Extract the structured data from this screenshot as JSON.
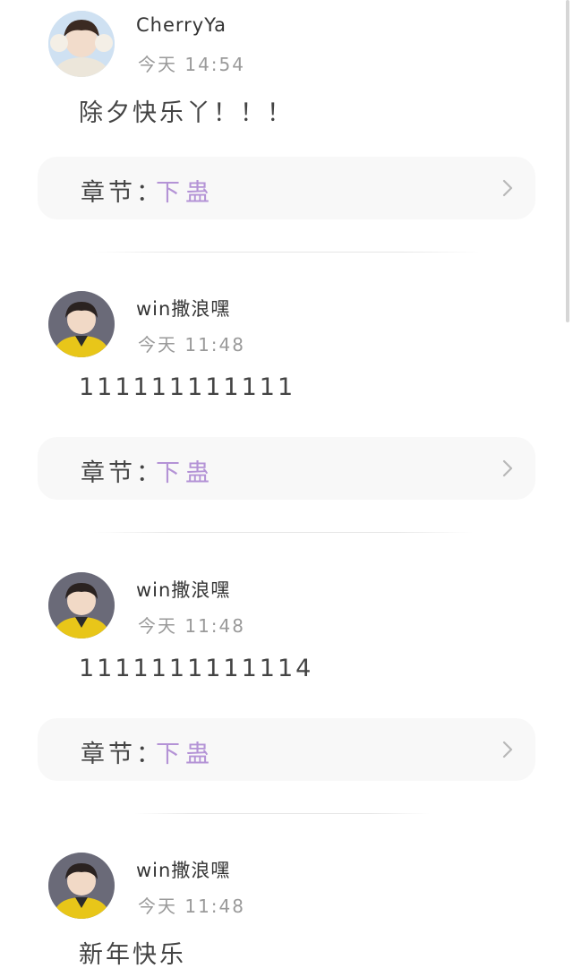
{
  "comments": [
    {
      "username": "CherryYa",
      "time": "今天 14:54",
      "text": "除夕快乐丫！！！",
      "chapter_label": "章节：",
      "chapter_name": "下蛊",
      "avatar_icon": "avatar-photo"
    },
    {
      "username": "win撒浪嘿",
      "time": "今天 11:48",
      "text": "111111111111",
      "chapter_label": "章节：",
      "chapter_name": "下蛊",
      "avatar_icon": "avatar-photo"
    },
    {
      "username": "win撒浪嘿",
      "time": "今天 11:48",
      "text": "1111111111114",
      "chapter_label": "章节：",
      "chapter_name": "下蛊",
      "avatar_icon": "avatar-photo"
    },
    {
      "username": "win撒浪嘿",
      "time": "今天 11:48",
      "text": "新年快乐",
      "avatar_icon": "avatar-photo"
    }
  ],
  "colors": {
    "chapter_link": "#b493d6",
    "card_background": "#f8f8f8",
    "muted_text": "#9a9a9a"
  }
}
